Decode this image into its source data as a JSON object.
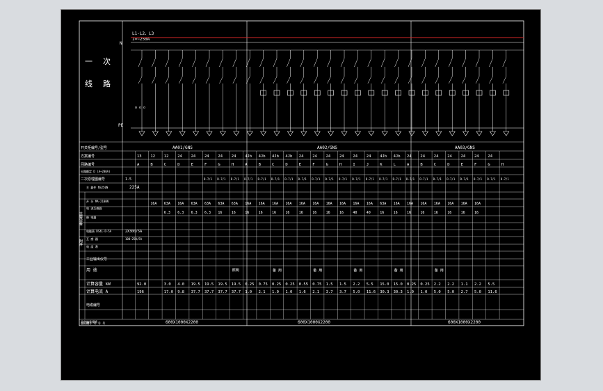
{
  "colors": {
    "background": "#000000",
    "frame": "#8a8a8a",
    "line": "#ffffff",
    "busbar": "#d62828",
    "text": "#ffffff"
  },
  "top_label": {
    "vertical_1": "一",
    "vertical_2": "次",
    "row_2a": "线",
    "row_2b": "路"
  },
  "bus": {
    "phases": "L1-L2、L3",
    "rating": "I=~250A",
    "n_label": "N",
    "pe_label": "PE",
    "dots": "o o o"
  },
  "panels": [
    "AA01/GNS",
    "AA02/GNS",
    "AA03/GNS"
  ],
  "row_labels": {
    "r1": "开关柜编号/型号",
    "r2": "方案编号",
    "r3": "回路编号",
    "r4": "分路额定 D (A~200A)",
    "r5": "二次原理图编号",
    "r6": "主  器件 NS250N",
    "r7": "开  头  MA-2100N",
    "r8": "电  流互感器",
    "r9": "继  电器",
    "r10": "电能表 DS4L-D-5A",
    "r11": "互  感  器",
    "r12": "电  度  表",
    "r13": "工业输出仪号",
    "r14": "用  途",
    "r15": "计算容量 kW",
    "r16": "计算电流 A",
    "r17": "电缆编号",
    "r18": "元件编号规格",
    "side_group_a": "主要设备",
    "side_group_b": "附件"
  },
  "main_header": {
    "r6_value": "225A",
    "r5_value": "1-5",
    "r10_value": "2X300/5A",
    "r11_value": "100~250/5A"
  },
  "columns": {
    "scheme": [
      "13",
      "12",
      "12",
      "24",
      "24",
      "24",
      "24",
      "24",
      "4Jb",
      "4Jb",
      "4Jb",
      "4Jb",
      "24",
      "24",
      "24",
      "24",
      "24",
      "24",
      "4Jb",
      "4Jb",
      "24",
      "24",
      "24",
      "24",
      "24",
      "24",
      "24"
    ],
    "circuit": [
      "A",
      "B",
      "C",
      "D",
      "E",
      "F",
      "G",
      "H",
      "A",
      "B",
      "C",
      "D",
      "E",
      "F",
      "G",
      "H",
      "I",
      "J",
      "K",
      "L",
      "A",
      "B",
      "C",
      "D",
      "E",
      "F",
      "G",
      "H"
    ],
    "breaker": [
      "",
      "16A",
      "63A",
      "16A",
      "63A",
      "63A",
      "63A",
      "63A",
      "16A",
      "16A",
      "16A",
      "16A",
      "16A",
      "16A",
      "16A",
      "16A",
      "16A",
      "16A",
      "63A",
      "16A",
      "16A",
      "16A",
      "16A",
      "16A",
      "16A",
      "16A"
    ],
    "ct": [
      "",
      "",
      "6.3",
      "6.3",
      "6.3",
      "6.3",
      "16",
      "16",
      "16",
      "16",
      "16",
      "16",
      "16",
      "16",
      "16",
      "16",
      "40",
      "40",
      "16",
      "16",
      "16",
      "16",
      "16",
      "16",
      "16",
      "16"
    ],
    "power": [
      "92.0",
      "",
      "3.0",
      "4.0",
      "19.5",
      "19.5",
      "19.5",
      "19.5",
      "0.25",
      "0.75",
      "0.25",
      "0.25",
      "0.55",
      "0.75",
      "1.5",
      "1.5",
      "2.2",
      "5.5",
      "15.0",
      "15.0",
      "0.25",
      "0.25",
      "2.2",
      "2.2",
      "1.1",
      "2.2",
      "5.5"
    ],
    "current": [
      "196",
      "",
      "17.0",
      "9.8",
      "37.7",
      "37.7",
      "37.7",
      "37.7",
      "1.0",
      "2.1",
      "1.0",
      "1.0",
      "1.6",
      "2.1",
      "3.7",
      "3.7",
      "5.0",
      "11.6",
      "30.3",
      "30.3",
      "1.0",
      "1.0",
      "5.0",
      "5.0",
      "2.7",
      "5.0",
      "11.6"
    ]
  },
  "uses": [
    "照明",
    "备  用",
    "备  用",
    "备  用",
    "备  用",
    "备  用"
  ],
  "footer": {
    "left_note": "图纸编号 号 号 号",
    "dims": [
      "600X1000X2200",
      "600X1000X2200",
      "600X1000X2200"
    ]
  }
}
